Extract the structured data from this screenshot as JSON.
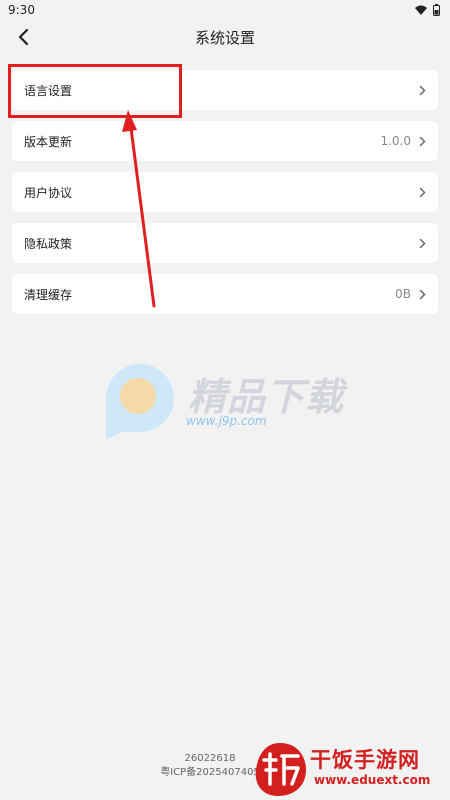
{
  "status_bar": {
    "time": "9:30",
    "icons": [
      "wifi-icon",
      "battery-icon"
    ]
  },
  "header": {
    "title": "系统设置",
    "back_icon": "chevron-left-icon"
  },
  "settings": {
    "items": [
      {
        "label": "语言设置",
        "value": ""
      },
      {
        "label": "版本更新",
        "value": "1.0.0"
      },
      {
        "label": "用户协议",
        "value": ""
      },
      {
        "label": "隐私政策",
        "value": ""
      },
      {
        "label": "清理缓存",
        "value": "0B"
      }
    ]
  },
  "footer": {
    "build": "26022618",
    "icp": "粤ICP备2025407405"
  },
  "watermark": {
    "text": "精品下载",
    "url": "www.j9p.com"
  },
  "site_logo": {
    "name": "干饭手游网",
    "url": "www.eduext.com"
  },
  "colors": {
    "annotation": "#e02020",
    "background": "#f2f2f2",
    "card": "#ffffff",
    "logo_red": "#d41f1f"
  }
}
